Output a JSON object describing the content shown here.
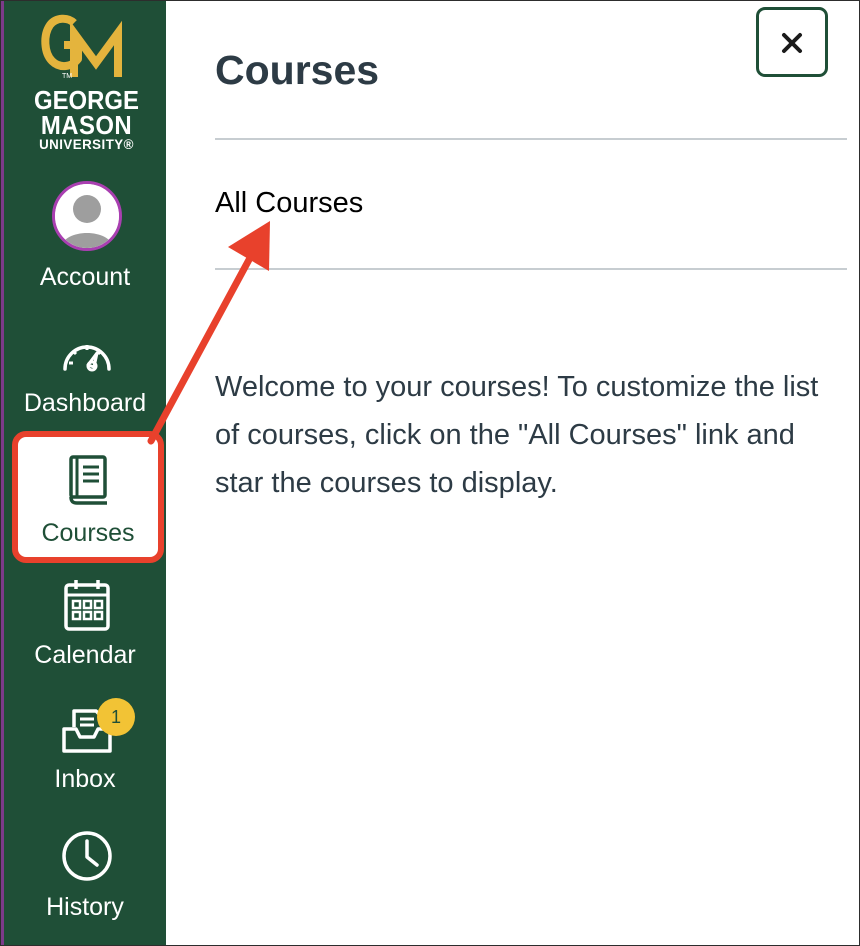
{
  "global_nav": {
    "logo": {
      "monogram": "GM",
      "tm": "TM",
      "line1": "GEORGE",
      "line2": "MASON",
      "line3": "UNIVERSITY®"
    },
    "items": [
      {
        "label": "Account",
        "icon": "avatar"
      },
      {
        "label": "Dashboard",
        "icon": "dashboard-gauge-icon"
      },
      {
        "label": "Courses",
        "icon": "courses-book-icon",
        "active": true
      },
      {
        "label": "Calendar",
        "icon": "calendar-icon"
      },
      {
        "label": "Inbox",
        "icon": "inbox-icon",
        "badge": "1"
      },
      {
        "label": "History",
        "icon": "clock-icon"
      }
    ]
  },
  "tray": {
    "title": "Courses",
    "close_icon": "close-icon",
    "all_courses_link": "All Courses",
    "welcome_text": "Welcome to your courses! To customize the list of courses, click on the \"All Courses\" link and star the courses to display."
  },
  "colors": {
    "nav_background": "#1f4f37",
    "logo_gold": "#e4b43d",
    "highlight_red": "#e8412c",
    "badge_yellow": "#f2c335",
    "avatar_ring": "#a93fb1",
    "heading_text": "#2d3b45"
  }
}
